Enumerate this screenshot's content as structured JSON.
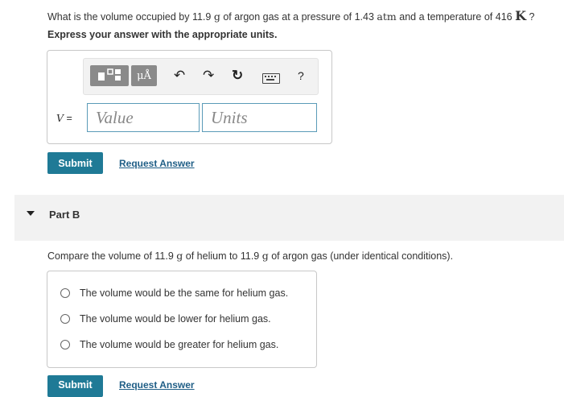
{
  "partA": {
    "question": {
      "prefix": "What is the volume occupied by 11.9 ",
      "unit_g1": "g",
      "mid1": " of argon gas at a pressure of 1.43 ",
      "unit_atm": "atm",
      "mid2": " and a temperature of 416 ",
      "unit_K": "K",
      "suffix": " ?"
    },
    "instruction": "Express your answer with the appropriate units.",
    "toolbar": {
      "unit_symbol": "μÅ",
      "help": "?"
    },
    "variable_label": "V",
    "equals": "=",
    "value_placeholder": "Value",
    "units_placeholder": "Units",
    "submit_label": "Submit",
    "request_label": "Request Answer"
  },
  "partB": {
    "title": "Part B",
    "compare": {
      "prefix": "Compare the volume of  11.9 ",
      "unit1": "g",
      "mid": " of helium to 11.9 ",
      "unit2": "g",
      "suffix": " of argon gas (under identical conditions)."
    },
    "options": [
      "The volume would be the same for helium gas.",
      "The volume would be lower for helium gas.",
      "The volume would be greater for helium gas."
    ],
    "submit_label": "Submit",
    "request_label": "Request Answer"
  }
}
